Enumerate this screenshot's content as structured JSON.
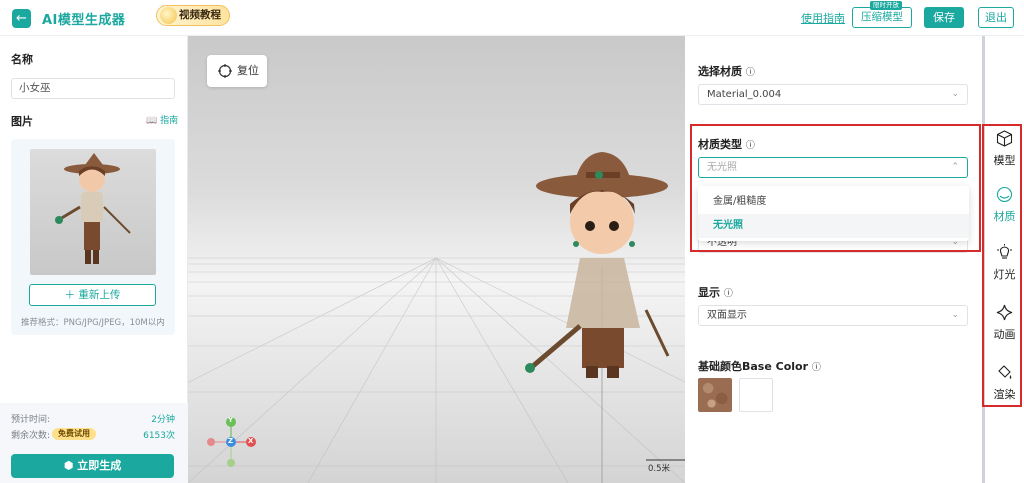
{
  "header": {
    "back_icon": "back-arrow-icon",
    "title": "AI模型生成器",
    "tutorial_label": "视频教程",
    "guide_link": "使用指南",
    "compress_label": "压缩模型",
    "limited_tag": "限时开放",
    "save_label": "保存",
    "exit_label": "退出",
    "accent_color": "#1aa89f"
  },
  "left": {
    "name_label": "名称",
    "name_value": "小女巫",
    "image_label": "图片",
    "guide_label": "指南",
    "reupload_label": "重新上传",
    "format_hint": "推荐格式：PNG/JPG/JPEG，10M以内",
    "est_time_label": "预计时间:",
    "est_time_value": "2分钟",
    "remaining_label": "剩余次数:",
    "free_tag": "免费试用",
    "remaining_value": "6153次",
    "generate_label": "立即生成"
  },
  "viewport": {
    "reset_label": "复位",
    "scale_label": "0.5米",
    "axis_y": "Y",
    "axis_z": "Z",
    "axis_x": "X"
  },
  "properties": {
    "material_label": "选择材质",
    "material_value": "Material_0.004",
    "type_label": "材质类型",
    "type_value": "无光照",
    "type_options": [
      "金属/粗糙度",
      "无光照"
    ],
    "hidden_value": "不透明",
    "display_label": "显示",
    "display_value": "双面显示",
    "base_color_label": "基础颜色Base Color"
  },
  "toolbar": {
    "items": [
      {
        "label": "模型",
        "icon": "cube-icon"
      },
      {
        "label": "材质",
        "icon": "material-icon"
      },
      {
        "label": "灯光",
        "icon": "bulb-icon"
      },
      {
        "label": "动画",
        "icon": "sparkle-icon"
      },
      {
        "label": "渲染",
        "icon": "paint-bucket-icon"
      }
    ],
    "active": "材质"
  }
}
